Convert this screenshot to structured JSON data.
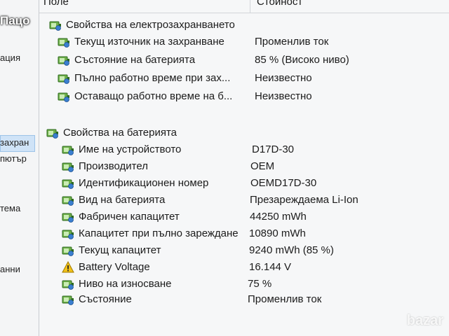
{
  "watermark": "Пацо",
  "logo": "bazar",
  "left_pane": {
    "fragments": [
      "ация",
      "захран",
      "пютър",
      "тема",
      "анни"
    ]
  },
  "header": {
    "field": "Поле",
    "value": "Стойност"
  },
  "groups": [
    {
      "title": "Свойства на електрозахранването",
      "items": [
        {
          "label": "Текущ източник на захранване",
          "value": "Променлив ток",
          "icon": "battery-icon"
        },
        {
          "label": "Състояние на батерията",
          "value": "85 % (Високо ниво)",
          "icon": "battery-icon"
        },
        {
          "label": "Пълно работно време при зах...",
          "value": "Неизвестно",
          "icon": "battery-icon"
        },
        {
          "label": "Оставащо работно време на б...",
          "value": "Неизвестно",
          "icon": "battery-icon"
        }
      ]
    },
    {
      "title": "Свойства на батерията",
      "items": [
        {
          "label": "Име на устройството",
          "value": "D17D-30",
          "icon": "battery-icon"
        },
        {
          "label": "Производител",
          "value": "OEM",
          "icon": "battery-icon"
        },
        {
          "label": "Идентификационен номер",
          "value": "OEMD17D-30",
          "icon": "battery-icon"
        },
        {
          "label": "Вид на батерията",
          "value": "Презареждаема Li-Ion",
          "icon": "battery-icon"
        },
        {
          "label": "Фабричен капацитет",
          "value": "44250 mWh",
          "icon": "battery-icon"
        },
        {
          "label": "Капацитет при пълно зареждане",
          "value": "10890 mWh",
          "icon": "battery-icon"
        },
        {
          "label": "Текущ капацитет",
          "value": "9240 mWh  (85 %)",
          "icon": "battery-icon"
        },
        {
          "label": "Battery Voltage",
          "value": "16.144 V",
          "icon": "warning-icon"
        },
        {
          "label": "Ниво на износване",
          "value": "75 %",
          "icon": "battery-icon"
        },
        {
          "label": "Състояние",
          "value": "Променлив ток",
          "icon": "battery-icon"
        }
      ]
    }
  ]
}
